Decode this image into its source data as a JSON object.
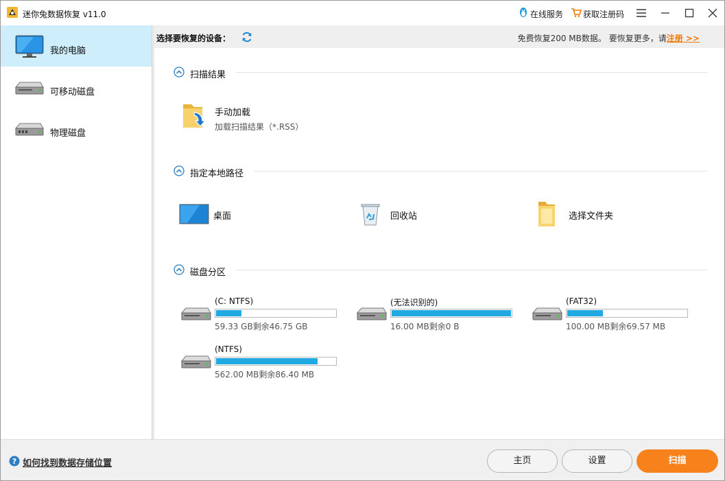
{
  "app": {
    "title": "迷你兔数据恢复 v11.0"
  },
  "titlebar": {
    "online_service": "在线服务",
    "get_code": "获取注册码"
  },
  "sidebar": {
    "items": [
      {
        "label": "我的电脑",
        "icon": "monitor-icon",
        "active": true
      },
      {
        "label": "可移动磁盘",
        "icon": "removable-disk-icon",
        "active": false
      },
      {
        "label": "物理磁盘",
        "icon": "physical-disk-icon",
        "active": false
      }
    ]
  },
  "header": {
    "label": "选择要恢复的设备：",
    "free_notice": "免费恢复200 MB数据。 要恢复更多，请",
    "register_link": "注册 >>"
  },
  "sections": {
    "scan_results": {
      "title": "扫描结果",
      "manual_load_title": "手动加载",
      "manual_load_sub": "加载扫描结果（*.RSS）"
    },
    "local_path": {
      "title": "指定本地路径",
      "items": [
        {
          "label": "桌面",
          "icon": "desktop-icon"
        },
        {
          "label": "回收站",
          "icon": "recycle-bin-icon"
        },
        {
          "label": "选择文件夹",
          "icon": "folder-icon"
        }
      ]
    },
    "partitions": {
      "title": "磁盘分区",
      "disks": [
        {
          "name": "(C: NTFS)",
          "info": "59.33 GB剩余46.75 GB",
          "used_fraction": 0.21
        },
        {
          "name": "(无法识别的)",
          "info": "16.00 MB剩余0 B",
          "used_fraction": 1.0
        },
        {
          "name": "(FAT32)",
          "info": "100.00 MB剩余69.57 MB",
          "used_fraction": 0.3
        },
        {
          "name": "(NTFS)",
          "info": "562.00 MB剩余86.40 MB",
          "used_fraction": 0.85
        }
      ]
    }
  },
  "footer": {
    "help_link": "如何找到数据存储位置",
    "home_button": "主页",
    "settings_button": "设置",
    "scan_button": "扫描"
  },
  "colors": {
    "accent_blue": "#21a9e1",
    "active_sidebar": "#cdeefa",
    "primary_orange": "#f7821b",
    "register_orange": "#f07800"
  }
}
